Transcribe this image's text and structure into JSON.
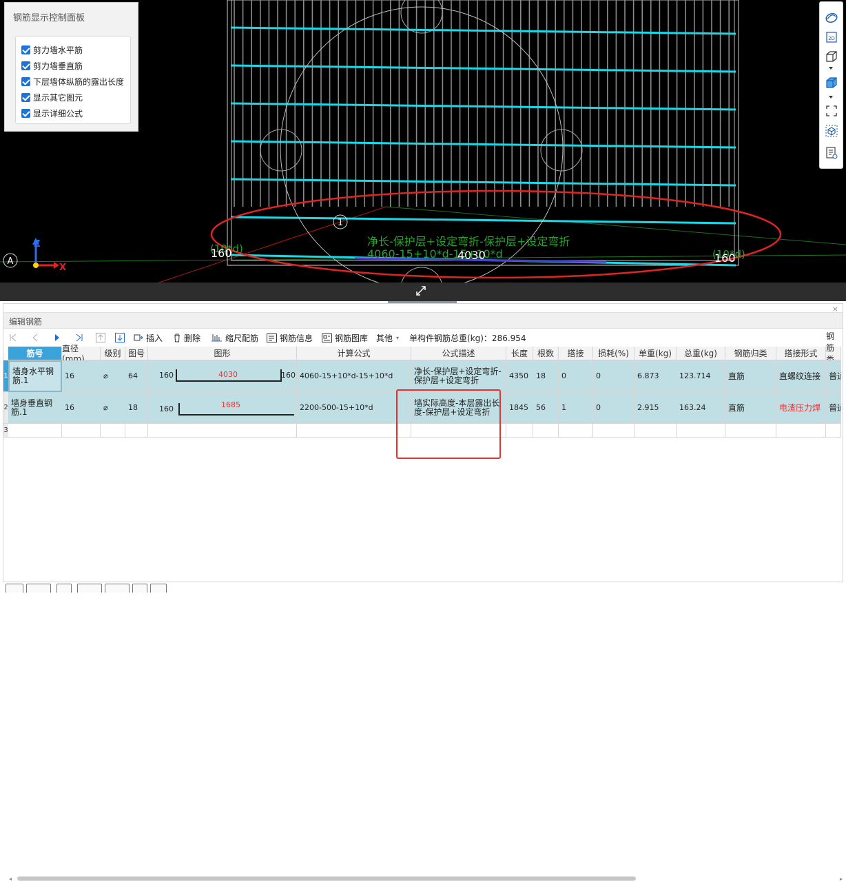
{
  "control_panel": {
    "title": "钢筋显示控制面板",
    "options": [
      {
        "label": "剪力墙水平筋",
        "checked": true
      },
      {
        "label": "剪力墙垂直筋",
        "checked": true
      },
      {
        "label": "下层墙体纵筋的露出长度",
        "checked": true
      },
      {
        "label": "显示其它图元",
        "checked": true
      },
      {
        "label": "显示详细公式",
        "checked": true
      }
    ]
  },
  "viewport": {
    "annotation_formula_text": "净长-保护层+设定弯折-保护层+设定弯折",
    "annotation_value_text": "4060-15+10*d-15+10*d",
    "dimension_total": "4030",
    "dimension_left": "160",
    "dimension_right": "160",
    "hook_left": "(10*d)",
    "hook_right": "(10*d)",
    "rebar_marker": "1",
    "axis_marker": "A",
    "axis_x": "X",
    "axis_z": "Z",
    "rebar_color": "#19d9e8"
  },
  "editor": {
    "title": "编辑钢筋",
    "close": "×",
    "toolbar": {
      "insert": "插入",
      "delete": "删除",
      "scale": "缩尺配筋",
      "info": "钢筋信息",
      "library": "钢筋图库",
      "other": "其他",
      "weight_text": "单构件钢筋总重(kg)：286.954"
    },
    "columns": [
      "筋号",
      "直径(mm)",
      "级别",
      "图号",
      "图形",
      "计算公式",
      "公式描述",
      "长度",
      "根数",
      "搭接",
      "损耗(%)",
      "单重(kg)",
      "总重(kg)",
      "钢筋归类",
      "搭接形式",
      "钢筋类型"
    ],
    "rows": [
      {
        "num": "1",
        "name": "墙身水平钢筋.1",
        "diameter": "16",
        "grade": "⌀",
        "shape_no": "64",
        "shape_left": "160",
        "shape_mid": "4030",
        "shape_right": "160",
        "formula": "4060-15+10*d-15+10*d",
        "desc": "净长-保护层+设定弯折-保护层+设定弯折",
        "length": "4350",
        "count": "18",
        "lap": "0",
        "loss": "0",
        "unit_w": "6.873",
        "total_w": "123.714",
        "category": "直筋",
        "lap_type": "直螺纹连接",
        "type": "普通"
      },
      {
        "num": "2",
        "name": "墙身垂直钢筋.1",
        "diameter": "16",
        "grade": "⌀",
        "shape_no": "18",
        "shape_left": "160",
        "shape_mid": "1685",
        "shape_right": "",
        "formula": "2200-500-15+10*d",
        "desc": "墙实际高度-本层露出长度-保护层+设定弯折",
        "length": "1845",
        "count": "56",
        "lap": "1",
        "loss": "0",
        "unit_w": "2.915",
        "total_w": "163.24",
        "category": "直筋",
        "lap_type": "电渣压力焊",
        "type": "普通"
      },
      {
        "num": "3"
      }
    ]
  }
}
